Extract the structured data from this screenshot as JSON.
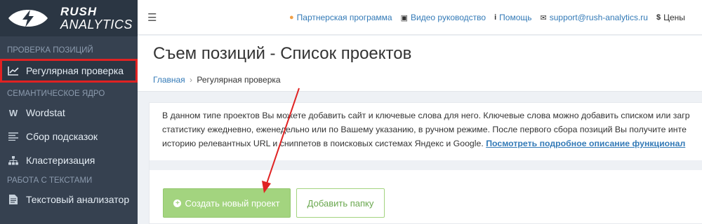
{
  "logo": {
    "line1": "RUSH",
    "line2": "ANALYTICS"
  },
  "sidebar": {
    "sections": [
      {
        "title": "ПРОВЕРКА ПОЗИЦИЙ"
      },
      {
        "title": "СЕМАНТИЧЕСКОЕ ЯДРО"
      },
      {
        "title": "РАБОТА С ТЕКСТАМИ"
      }
    ],
    "items": [
      {
        "label": "Регулярная проверка",
        "icon": "chart-line-icon"
      },
      {
        "label": "Wordstat",
        "icon": "wordstat-w-icon"
      },
      {
        "label": "Сбор подсказок",
        "icon": "list-icon"
      },
      {
        "label": "Кластеризация",
        "icon": "sitemap-icon"
      },
      {
        "label": "Текстовый анализатор",
        "icon": "document-icon"
      }
    ]
  },
  "header": {
    "links": [
      {
        "label": "Партнерская программа",
        "icon": "partners-icon"
      },
      {
        "label": "Видео руководство",
        "icon": "film-icon"
      },
      {
        "label": "Помощь",
        "icon": "info-icon"
      },
      {
        "label": "support@rush-analytics.ru",
        "icon": "envelope-icon"
      },
      {
        "label": "Цены",
        "icon": "dollar-icon"
      }
    ]
  },
  "page": {
    "title": "Съем позиций - Список проектов",
    "breadcrumb": {
      "home": "Главная",
      "separator": "›",
      "current": "Регулярная проверка"
    }
  },
  "description": {
    "line1": "В данном типе проектов Вы можете добавить сайт и ключевые слова для него. Ключевые слова можно добавить списком или загр",
    "line2": "статистику ежедневно, еженедельно или по Вашему указанию, в ручном режиме. После первого сбора позиций Вы получите инте",
    "line3": "историю релевантных URL и сниппетов в поисковых системах Яндекс и Google.",
    "more_link": "Посмотреть подробное описание функционал"
  },
  "buttons": {
    "create": "Создать новый проект",
    "add_folder": "Добавить папку"
  },
  "colors": {
    "sidebar": "#364150",
    "accent_green": "#a3d47f",
    "link_blue": "#337ab7",
    "annotation_red": "#e02222"
  }
}
